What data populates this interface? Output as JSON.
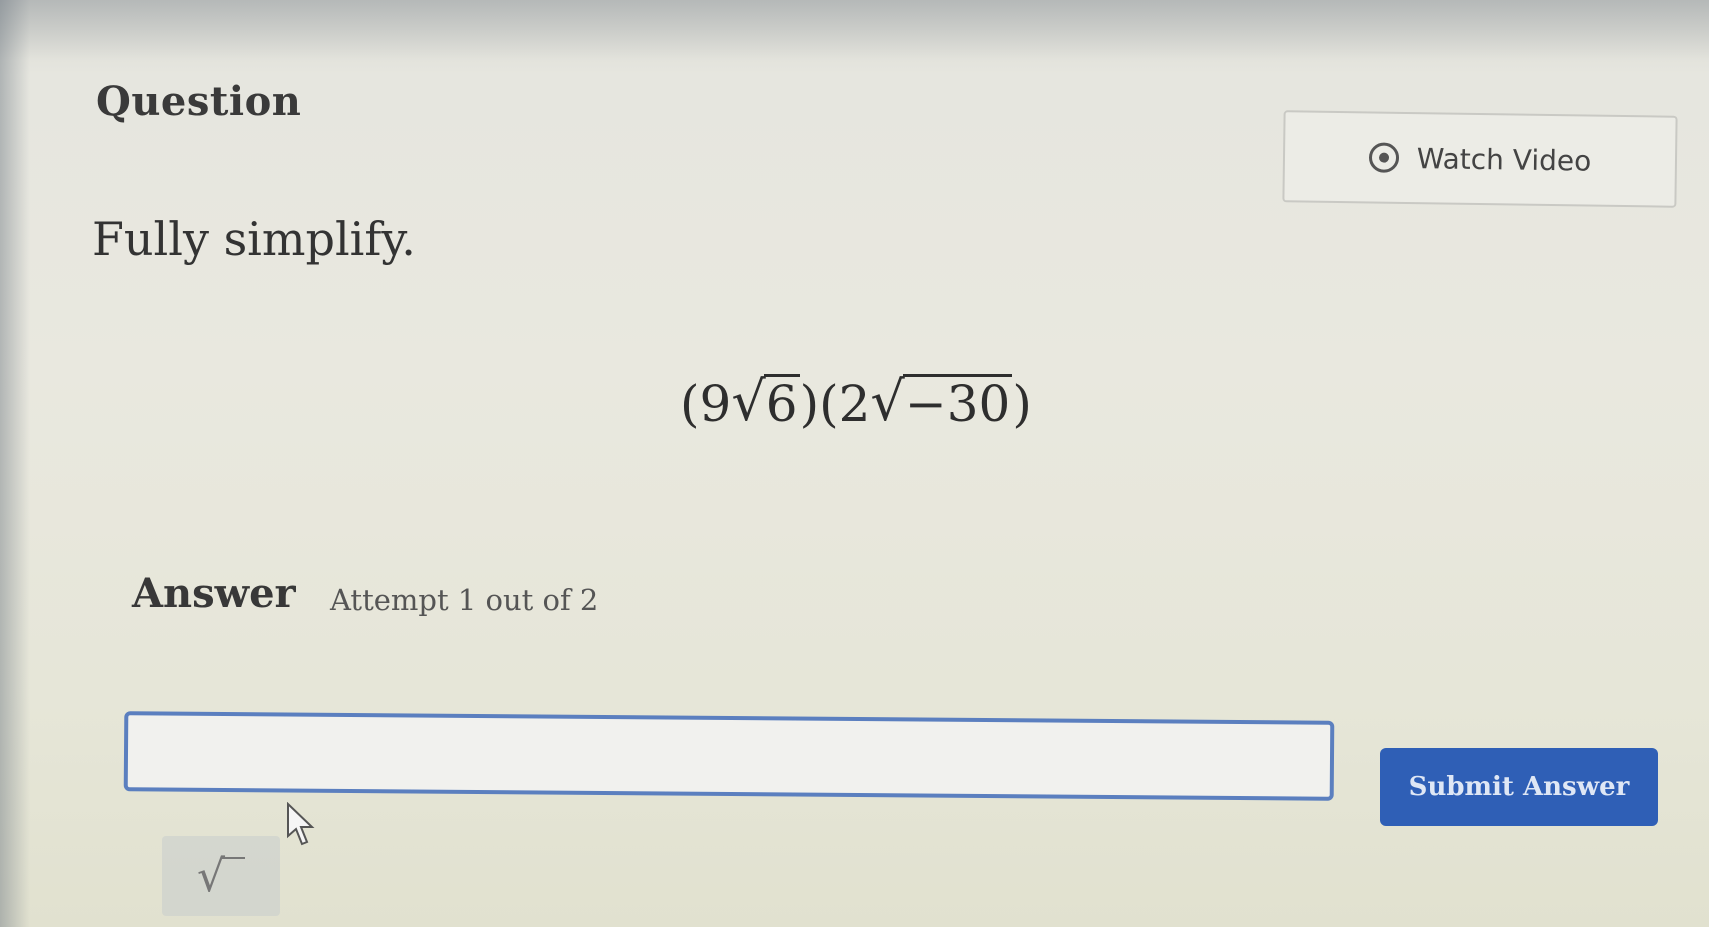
{
  "question": {
    "title": "Question",
    "watch_video_label": "Watch Video",
    "prompt": "Fully simplify.",
    "expression": {
      "open1": "(",
      "coef1": "9",
      "radicand1": "6",
      "close1": ")",
      "open2": "(",
      "coef2": "2",
      "radicand2": "−30",
      "close2": ")"
    }
  },
  "answer": {
    "label": "Answer",
    "attempt_text": "Attempt 1 out of 2",
    "input_value": "",
    "submit_label": "Submit Answer",
    "tool_icon": "sqrt-icon"
  },
  "colors": {
    "submit_bg": "#2f5fb6",
    "input_border": "#5b7fbf"
  }
}
